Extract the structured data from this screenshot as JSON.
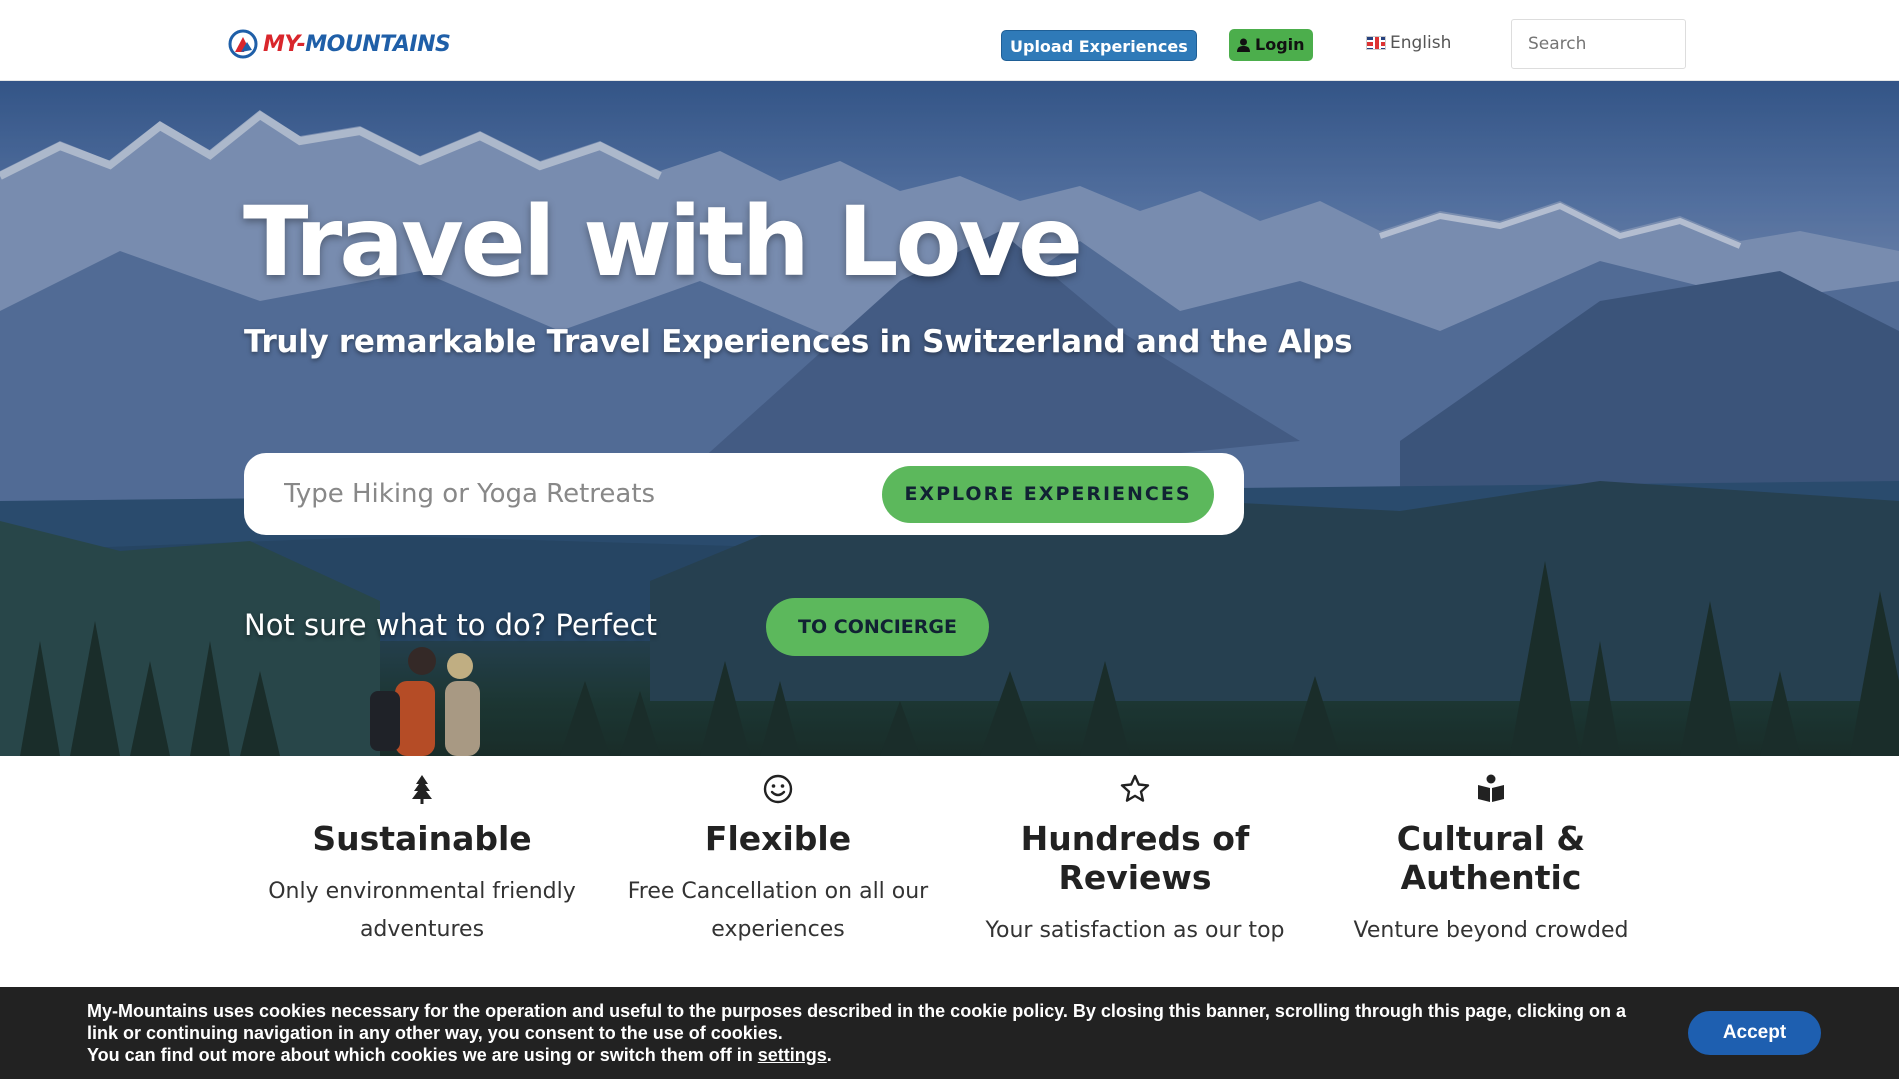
{
  "header": {
    "logo": {
      "part1": "MY-",
      "part2": "MOUNTAINS"
    },
    "upload_label": "Upload Experiences",
    "login_label": "Login",
    "language_label": "English",
    "search_placeholder": "Search"
  },
  "hero": {
    "title": "Travel with Love",
    "subtitle": "Truly remarkable Travel Experiences in Switzerland and the Alps",
    "explore_placeholder": "Type Hiking or Yoga Retreats",
    "explore_button": "EXPLORE EXPERIENCES",
    "not_sure_text": "Not sure what to do? Perfect",
    "concierge_button": "TO CONCIERGE"
  },
  "features": [
    {
      "icon": "tree-icon",
      "title": "Sustainable",
      "text": "Only environmental friendly adventures"
    },
    {
      "icon": "smile-icon",
      "title": "Flexible",
      "text": "Free Cancellation on all our experiences"
    },
    {
      "icon": "star-icon",
      "title": "Hundreds of Reviews",
      "text": "Your satisfaction as our top"
    },
    {
      "icon": "book-reader-icon",
      "title": "Cultural & Authentic",
      "text": "Venture beyond crowded"
    }
  ],
  "cookie": {
    "line1": "My-Mountains uses cookies necessary for the operation and useful to the purposes described in the cookie policy. By closing this banner, scrolling through this page, clicking on a link or continuing navigation in any other way, you consent to the use of cookies.",
    "line2_prefix": "You can find out more about which cookies we are using or switch them off in ",
    "settings_link": "settings",
    "line2_suffix": ".",
    "accept_button": "Accept"
  },
  "colors": {
    "brand_red": "#d9262c",
    "brand_blue": "#1f5fa8",
    "accent_green": "#5cb85c",
    "upload_blue": "#2f7ab8",
    "cookie_bg": "#222222",
    "accept_blue": "#1e5fb0"
  }
}
